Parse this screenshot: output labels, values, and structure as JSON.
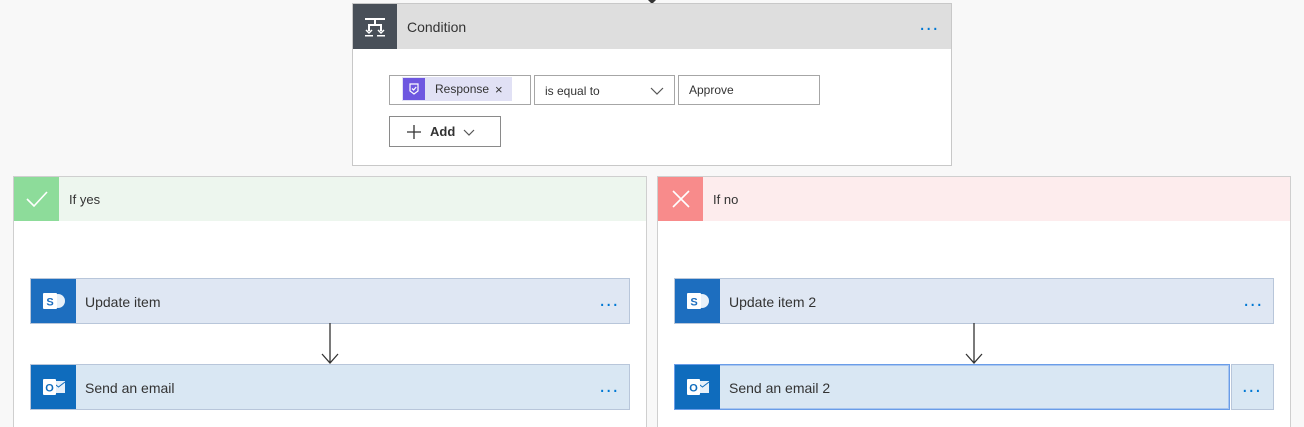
{
  "condition": {
    "title": "Condition",
    "more": "...",
    "token_label": "Response",
    "token_remove": "×",
    "operator": "is equal to",
    "value": "Approve",
    "add_label": "Add"
  },
  "branches": {
    "yes": {
      "title": "If yes",
      "actions": [
        {
          "title": "Update item",
          "more": "...",
          "icon": "sharepoint-icon"
        },
        {
          "title": "Send an email",
          "more": "...",
          "icon": "outlook-icon"
        }
      ]
    },
    "no": {
      "title": "If no",
      "actions": [
        {
          "title": "Update item 2",
          "more": "...",
          "icon": "sharepoint-icon"
        },
        {
          "title": "Send an email 2",
          "more": "...",
          "icon": "outlook-icon"
        }
      ]
    }
  },
  "colors": {
    "accent": "#0078d4",
    "yes": "#8ddc9a",
    "no": "#f88b8b",
    "token": "#6e57e0"
  }
}
